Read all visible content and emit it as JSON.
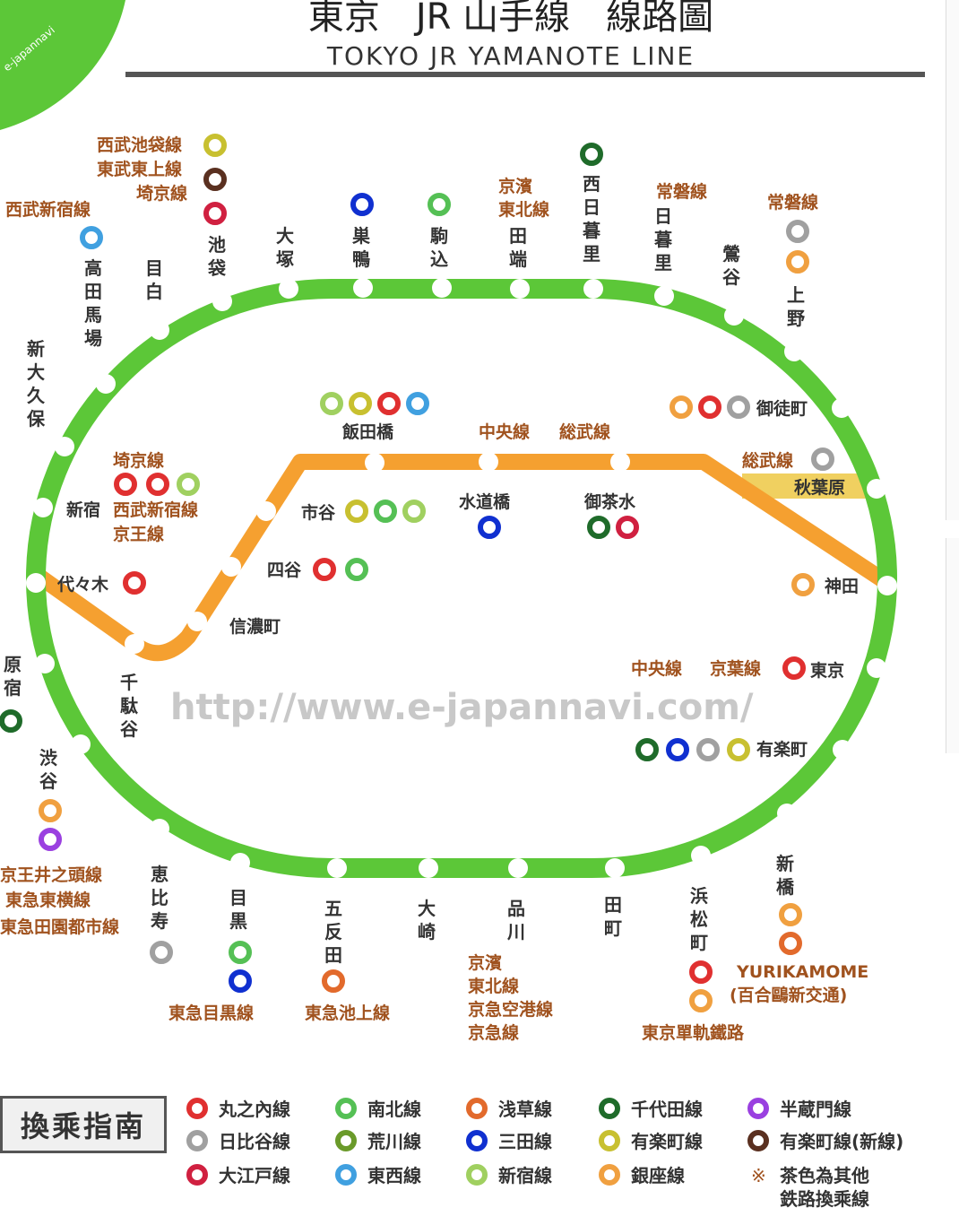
{
  "title": {
    "zh": "東京　JR 山手線　線路圖",
    "en": "TOKYO JR YAMANOTE LINE"
  },
  "watermark": "http://www.e-japannavi.com/",
  "corner_text": "e-japannavi",
  "stations": {
    "ikebukuro": "池\n袋",
    "otsuka": "大\n塚",
    "sugamo": "巣\n鴨",
    "komagome": "駒\n込",
    "tabata": "田\n端",
    "nishinippori": "西\n日\n暮\n里",
    "nippori": "日\n暮\n里",
    "uguisudani": "鶯\n谷",
    "ueno": "上\n野",
    "okachimachi": "御徒町",
    "akihabara": "秋葉原",
    "kanda": "神田",
    "tokyo": "東京",
    "yurakucho": "有楽町",
    "shimbashi": "新\n橋",
    "hamamatsucho": "浜\n松\n町",
    "tamachi": "田\n町",
    "shinagawa": "品\n川",
    "osaki": "大\n崎",
    "gotanda": "五\n反\n田",
    "meguro": "目\n黒",
    "ebisu": "恵\n比\n寿",
    "shibuya": "渋\n谷",
    "harajuku": "原\n宿",
    "yoyogi": "代々木",
    "shinjuku": "新宿",
    "shinokubo": "新\n大\n久\n保",
    "takadanobaba": "高\n田\n馬\n場",
    "mejiro": "目\n白",
    "iidabashi": "飯田橋",
    "ichigaya": "市谷",
    "yotsuya": "四谷",
    "shinanomachi": "信濃町",
    "sendagaya": "千\n駄\n谷",
    "suidobashi": "水道橋",
    "ochanomizu": "御茶水"
  },
  "transfer_labels": {
    "seibu_ikebukuro": "西武池袋線",
    "tobu_tojo": "東武東上線",
    "saikyo_1": "埼京線",
    "seibu_shinjuku_1": "西武新宿線",
    "keihin_tohoku_1": "京濱\n東北線",
    "joban_1": "常磐線",
    "joban_2": "常磐線",
    "chuo_1": "中央線",
    "sobu_1": "総武線",
    "sobu_2": "総武線",
    "saikyo_2": "埼京線",
    "seibu_shinjuku_2": "西武新宿線",
    "keio": "京王線",
    "chuo_2": "中央線",
    "keiyo": "京葉線",
    "keio_inokashira": "京王井之頭線",
    "tokyu_toyoko": "東急東横線",
    "tokyu_denentoshi": "東急田園都市線",
    "tokyu_meguro": "東急目黒線",
    "tokyu_ikegami": "東急池上線",
    "shinagawa_lines": "京濱\n東北線\n京急空港線\n京急線",
    "yurikamome": "YURIKAMOME",
    "yurikamome_zh": "(百合鷗新交通)",
    "monorail": "東京單軌鐵路"
  },
  "legend": {
    "title": "換乘指南",
    "items": [
      {
        "label": "丸之內線",
        "color": "#e03030"
      },
      {
        "label": "南北線",
        "color": "#55c055"
      },
      {
        "label": "浅草線",
        "color": "#e26a2c"
      },
      {
        "label": "千代田線",
        "color": "#1f6b2a"
      },
      {
        "label": "半蔵門線",
        "color": "#9a40e0"
      },
      {
        "label": "日比谷線",
        "color": "#a0a0a0"
      },
      {
        "label": "荒川線",
        "color": "#6a9a2a"
      },
      {
        "label": "三田線",
        "color": "#1030d0"
      },
      {
        "label": "有楽町線",
        "color": "#c8c030"
      },
      {
        "label": "有楽町線(新線)",
        "color": "#5a3020"
      },
      {
        "label": "大江戸線",
        "color": "#d02040"
      },
      {
        "label": "東西線",
        "color": "#40a0e0"
      },
      {
        "label": "新宿線",
        "color": "#a0d060"
      },
      {
        "label": "銀座線",
        "color": "#f0a040"
      }
    ],
    "note": "茶色為其他\n鉄路換乘線",
    "note_mark": "※"
  },
  "colors": {
    "yamanote": "#5cc738",
    "chuo": "#f5a030",
    "akiba_band": "#f0d060",
    "brown_text": "#a0521e"
  }
}
